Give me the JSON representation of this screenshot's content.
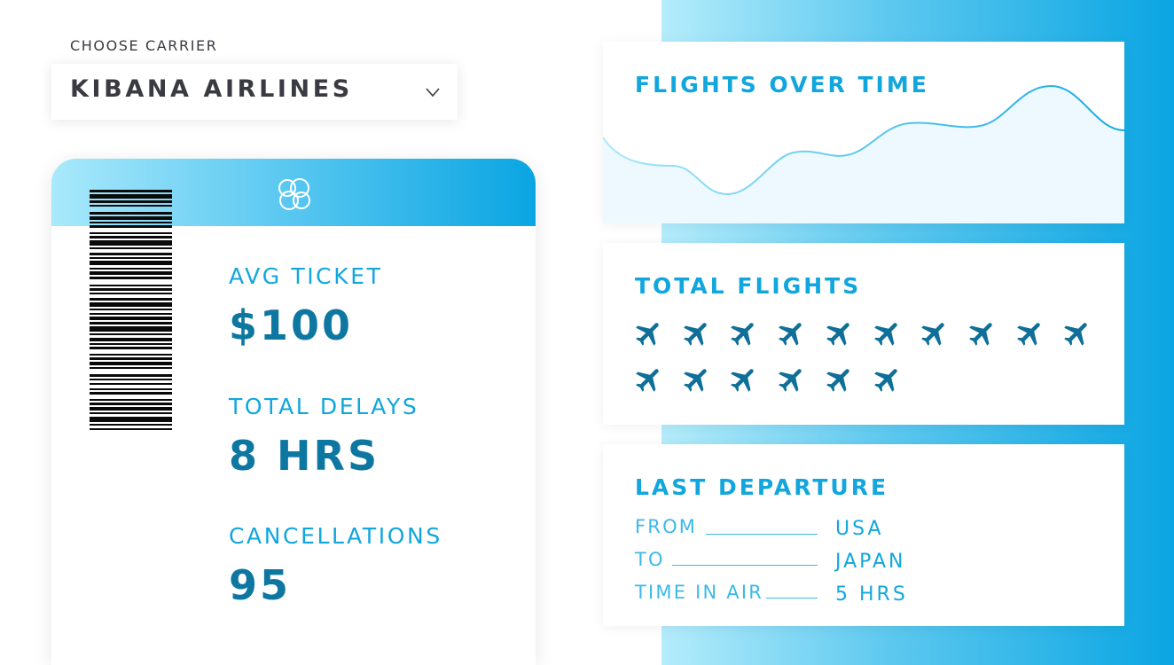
{
  "carrier": {
    "label": "CHOOSE CARRIER",
    "selected": "KIBANA AIRLINES"
  },
  "ticket": {
    "stats": [
      {
        "label": "AVG TICKET",
        "value": "$100"
      },
      {
        "label": "TOTAL DELAYS",
        "value": "8 HRS"
      },
      {
        "label": "CANCELLATIONS",
        "value": "95"
      }
    ]
  },
  "flights_over_time": {
    "title": "FLIGHTS OVER TIME"
  },
  "total_flights": {
    "title": "TOTAL FLIGHTS",
    "plane_count": 16
  },
  "last_departure": {
    "title": "LAST DEPARTURE",
    "rows": [
      {
        "label": "FROM",
        "value": "USA"
      },
      {
        "label": "TO",
        "value": "JAPAN"
      },
      {
        "label": "TIME IN AIR",
        "value": "5 HRS"
      }
    ]
  },
  "colors": {
    "accent": "#11a6dd",
    "value_dark": "#0d77a2",
    "plane": "#0f6f99",
    "text_dark": "#3a3a42"
  },
  "icons": [
    "chevron-down-icon",
    "elastic-logo-icon",
    "barcode",
    "plane-icon"
  ]
}
